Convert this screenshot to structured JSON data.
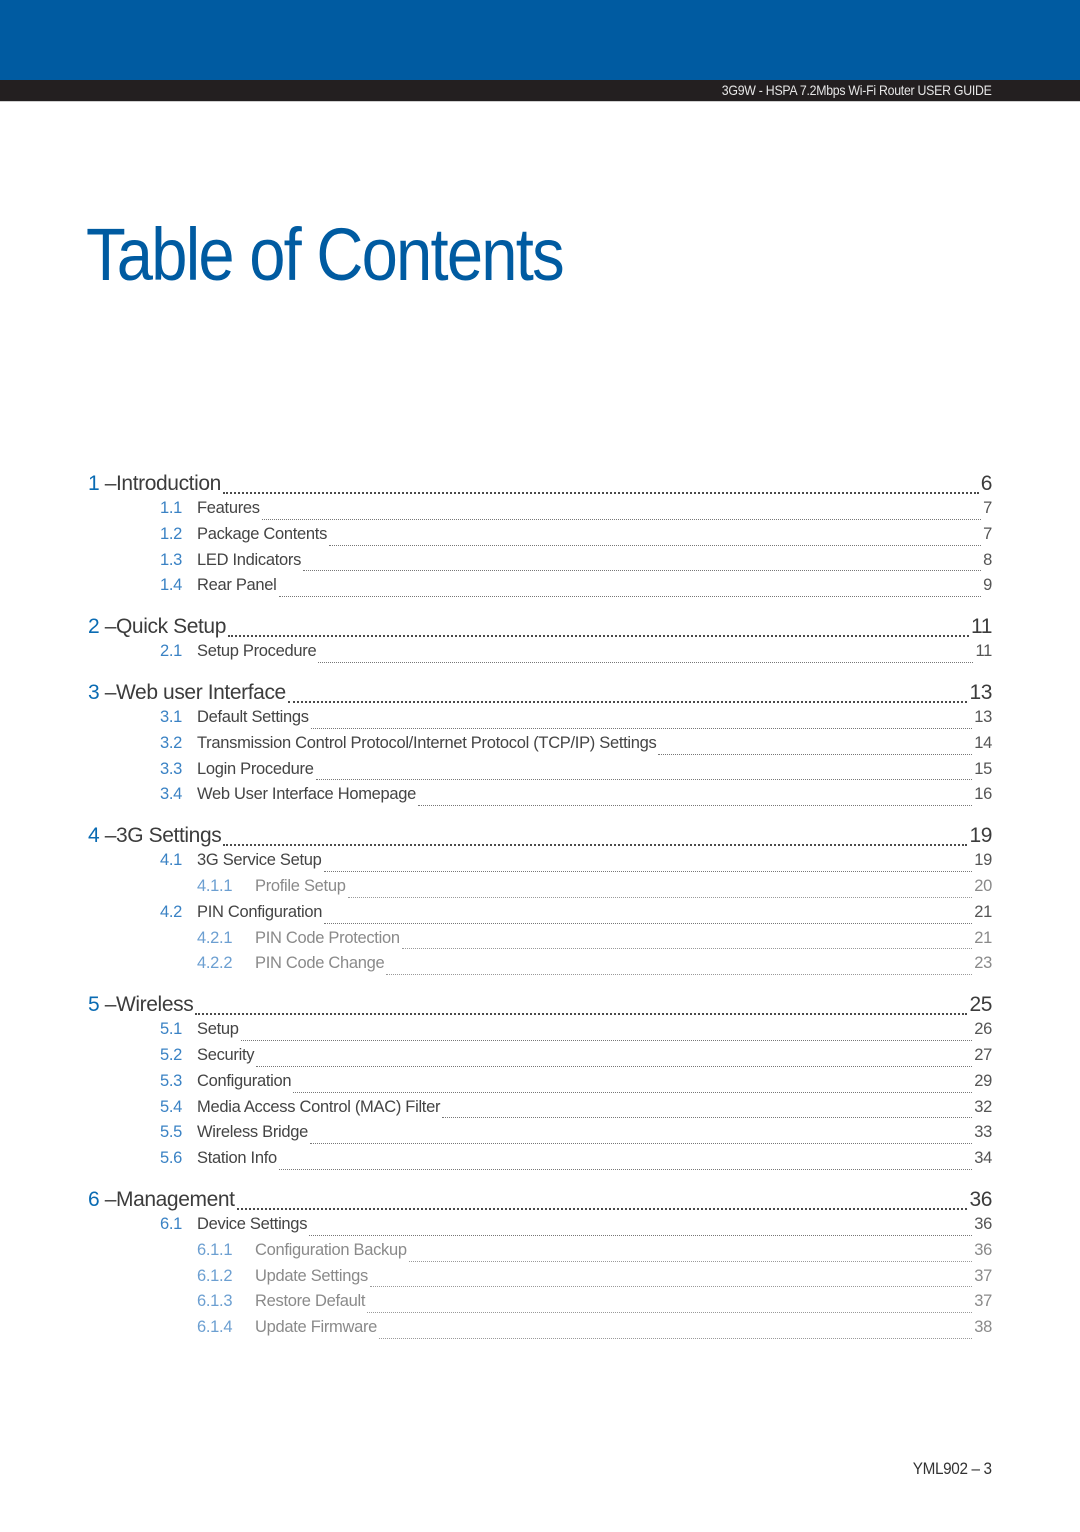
{
  "header": {
    "guide_title": "3G9W - HSPA 7.2Mbps Wi-Fi Router USER GUIDE",
    "brand_color": "#005ba1",
    "band_color": "#231f20"
  },
  "page_title": "Table of Contents",
  "toc": [
    {
      "num": "1",
      "title": "Introduction",
      "page": "6",
      "items": [
        {
          "num": "1.1",
          "title": "Features",
          "page": "7"
        },
        {
          "num": "1.2",
          "title": "Package Contents",
          "page": "7"
        },
        {
          "num": "1.3",
          "title": "LED Indicators",
          "page": "8"
        },
        {
          "num": "1.4",
          "title": "Rear Panel",
          "page": "9"
        }
      ]
    },
    {
      "num": "2",
      "title": "Quick Setup",
      "page": "11",
      "items": [
        {
          "num": "2.1",
          "title": "Setup Procedure",
          "page": "11"
        }
      ]
    },
    {
      "num": "3",
      "title": "Web user Interface",
      "page": "13",
      "items": [
        {
          "num": "3.1",
          "title": "Default Settings",
          "page": "13"
        },
        {
          "num": "3.2",
          "title": "Transmission Control Protocol/Internet Protocol (TCP/IP) Settings",
          "page": "14"
        },
        {
          "num": "3.3",
          "title": "Login Procedure",
          "page": "15"
        },
        {
          "num": "3.4",
          "title": "Web User Interface Homepage",
          "page": "16"
        }
      ]
    },
    {
      "num": "4",
      "title": "3G Settings",
      "page": "19",
      "items": [
        {
          "num": "4.1",
          "title": "3G Service Setup",
          "page": "19",
          "items": [
            {
              "num": "4.1.1",
              "title": "Profile Setup",
              "page": "20"
            }
          ]
        },
        {
          "num": "4.2",
          "title": "PIN Configuration",
          "page": "21",
          "items": [
            {
              "num": "4.2.1",
              "title": "PIN Code Protection",
              "page": "21"
            },
            {
              "num": "4.2.2",
              "title": "PIN Code Change",
              "page": "23"
            }
          ]
        }
      ]
    },
    {
      "num": "5",
      "title": "Wireless",
      "page": "25",
      "items": [
        {
          "num": "5.1",
          "title": "Setup",
          "page": "26"
        },
        {
          "num": "5.2",
          "title": "Security",
          "page": "27"
        },
        {
          "num": "5.3",
          "title": "Configuration",
          "page": "29"
        },
        {
          "num": "5.4",
          "title": "Media Access Control (MAC) Filter",
          "page": "32"
        },
        {
          "num": "5.5",
          "title": "Wireless Bridge",
          "page": "33"
        },
        {
          "num": "5.6",
          "title": "Station Info",
          "page": "34"
        }
      ]
    },
    {
      "num": "6",
      "title": "Management",
      "page": "36",
      "items": [
        {
          "num": "6.1",
          "title": "Device Settings",
          "page": "36",
          "items": [
            {
              "num": "6.1.1",
              "title": "Configuration Backup",
              "page": "36"
            },
            {
              "num": "6.1.2",
              "title": "Update Settings",
              "page": "37"
            },
            {
              "num": "6.1.3",
              "title": "Restore Default",
              "page": "37"
            },
            {
              "num": "6.1.4",
              "title": "Update Firmware",
              "page": "38"
            }
          ]
        }
      ]
    }
  ],
  "footer": {
    "page_label": "YML902 – 3"
  }
}
